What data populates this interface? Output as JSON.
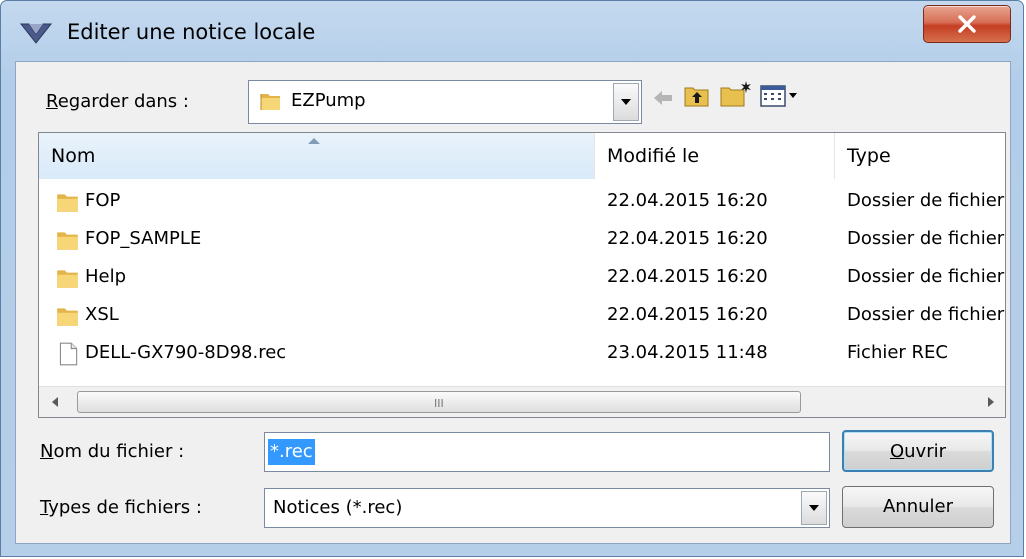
{
  "window": {
    "title": "Editer une notice locale",
    "close_glyph": "X"
  },
  "lookin": {
    "label": "Regarder dans :",
    "label_mnemonic": "R",
    "label_rest": "egarder dans :",
    "value": "EZPump"
  },
  "toolbar": {
    "icons": [
      "back-arrow-icon",
      "up-folder-icon",
      "new-folder-icon",
      "view-menu-icon"
    ]
  },
  "columns": [
    {
      "key": "name",
      "label": "Nom"
    },
    {
      "key": "modified",
      "label": "Modifié le"
    },
    {
      "key": "type",
      "label": "Type"
    }
  ],
  "files": [
    {
      "name": "FOP",
      "modified": "22.04.2015 16:20",
      "type": "Dossier de fichier",
      "kind": "folder"
    },
    {
      "name": "FOP_SAMPLE",
      "modified": "22.04.2015 16:20",
      "type": "Dossier de fichier",
      "kind": "folder"
    },
    {
      "name": "Help",
      "modified": "22.04.2015 16:20",
      "type": "Dossier de fichier",
      "kind": "folder"
    },
    {
      "name": "XSL",
      "modified": "22.04.2015 16:20",
      "type": "Dossier de fichier",
      "kind": "folder"
    },
    {
      "name": "DELL-GX790-8D98.rec",
      "modified": "23.04.2015 11:48",
      "type": "Fichier REC",
      "kind": "file"
    }
  ],
  "filename": {
    "label_mnemonic": "N",
    "label_rest": "om du fichier :",
    "value": "*.rec"
  },
  "filetypes": {
    "label_mnemonic": "T",
    "label_rest": "ypes de fichiers :",
    "value": "Notices (*.rec)"
  },
  "buttons": {
    "open_mnemonic": "O",
    "open_rest": "uvrir",
    "cancel": "Annuler"
  },
  "scrollbar": {
    "grip": "III"
  },
  "colors": {
    "selection": "#3399ff",
    "close_red": "#c43e23",
    "frame_blue": "#b6cfe8"
  }
}
